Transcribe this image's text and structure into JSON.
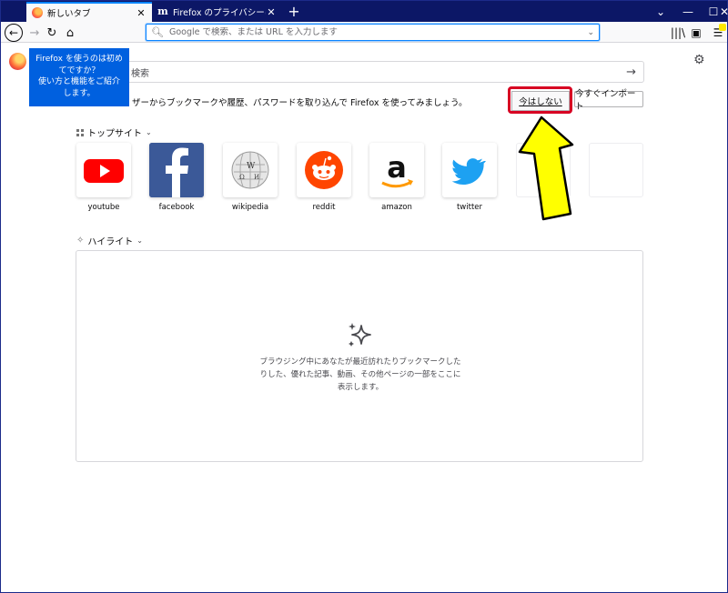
{
  "tabs": [
    {
      "title": "新しいタブ",
      "active": true
    },
    {
      "title": "Firefox のプライバシーに関する通知",
      "active": false
    }
  ],
  "toolbar": {
    "urlbar_placeholder": "Google で検索、または URL を入力します"
  },
  "newtab": {
    "search_placeholder": "検索",
    "tooltip": [
      "Firefox を使うのは初め",
      "てですか？",
      "使い方と機能をご紹介",
      "します。"
    ],
    "import_text": "ザーからブックマークや履歴、パスワードを取り込んで Firefox を使ってみましょう。",
    "not_now_label": "今はしない",
    "import_now_label": "今すぐインポート",
    "topsites_heading": "トップサイト",
    "highlights_heading": "ハイライト",
    "highlights_empty": "ブラウジング中にあなたが最近訪れたりブックマークしたりした、優れた記事、動画、その他ページの一部をここに表示します。"
  },
  "topsites": [
    {
      "label": "youtube",
      "icon": "youtube-logo"
    },
    {
      "label": "facebook",
      "icon": "facebook-logo"
    },
    {
      "label": "wikipedia",
      "icon": "wikipedia-logo"
    },
    {
      "label": "reddit",
      "icon": "reddit-logo"
    },
    {
      "label": "amazon",
      "icon": "amazon-logo"
    },
    {
      "label": "twitter",
      "icon": "twitter-logo"
    }
  ],
  "colors": {
    "titlebar": "#0c1766",
    "accent": "#0a84ff",
    "tooltip": "#0060df",
    "highlight_box": "#d70022",
    "arrow_fill": "#ffff00"
  }
}
